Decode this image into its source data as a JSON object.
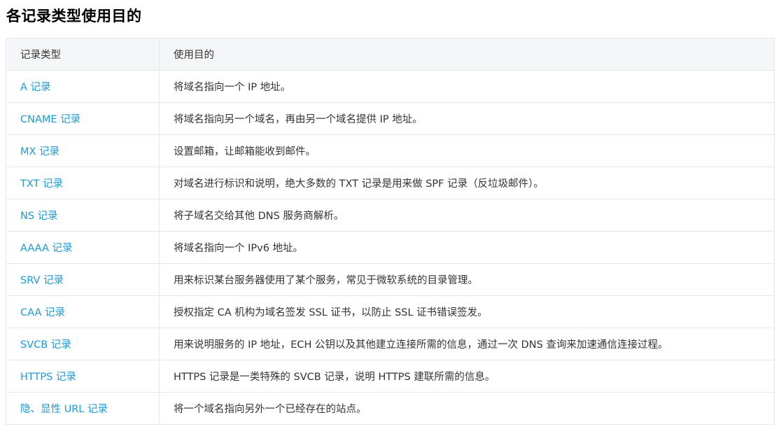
{
  "page": {
    "title": "各记录类型使用目的"
  },
  "table": {
    "headers": {
      "type": "记录类型",
      "purpose": "使用目的"
    },
    "rows": [
      {
        "type": "A 记录",
        "purpose": "将域名指向一个 IP 地址。"
      },
      {
        "type": "CNAME 记录",
        "purpose": "将域名指向另一个域名，再由另一个域名提供 IP 地址。"
      },
      {
        "type": "MX 记录",
        "purpose": "设置邮箱，让邮箱能收到邮件。"
      },
      {
        "type": "TXT 记录",
        "purpose": "对域名进行标识和说明，绝大多数的 TXT 记录是用来做 SPF 记录（反垃圾邮件）。"
      },
      {
        "type": "NS 记录",
        "purpose": "将子域名交给其他 DNS 服务商解析。"
      },
      {
        "type": "AAAA 记录",
        "purpose": "将域名指向一个 IPv6 地址。"
      },
      {
        "type": "SRV 记录",
        "purpose": "用来标识某台服务器使用了某个服务，常见于微软系统的目录管理。"
      },
      {
        "type": "CAA 记录",
        "purpose": "授权指定 CA 机构为域名签发 SSL 证书，以防止 SSL 证书错误签发。"
      },
      {
        "type": "SVCB 记录",
        "purpose": "用来说明服务的 IP 地址，ECH 公钥以及其他建立连接所需的信息，通过一次 DNS 查询来加速通信连接过程。"
      },
      {
        "type": "HTTPS 记录",
        "purpose": "HTTPS 记录是一类特殊的 SVCB 记录，说明 HTTPS 建联所需的信息。"
      },
      {
        "type": "隐、显性 URL 记录",
        "purpose": "将一个域名指向另外一个已经存在的站点。"
      }
    ]
  },
  "colors": {
    "link": "#1a9bd7",
    "header_bg": "#f5f6f8",
    "border": "#e5e7eb",
    "text": "#333333"
  }
}
